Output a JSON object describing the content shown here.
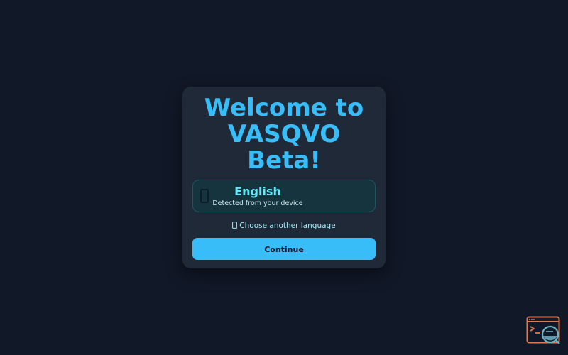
{
  "welcome": {
    "title_lines": [
      "Welcome to",
      "VASQVO",
      "Beta!"
    ]
  },
  "language": {
    "name": "English",
    "detected_note": "Detected from your device",
    "icon": "globe-icon"
  },
  "choose_language": {
    "label": "Choose another language",
    "icon": "globe-icon"
  },
  "continue_button": {
    "label": "Continue"
  },
  "corner_widget": {
    "icon": "debug-console-icon"
  },
  "colors": {
    "background": "#111827",
    "card": "#1f2937",
    "accent": "#38bdf8",
    "language_highlight": "#67e8f9",
    "corner_widget": "#e07a4f"
  }
}
